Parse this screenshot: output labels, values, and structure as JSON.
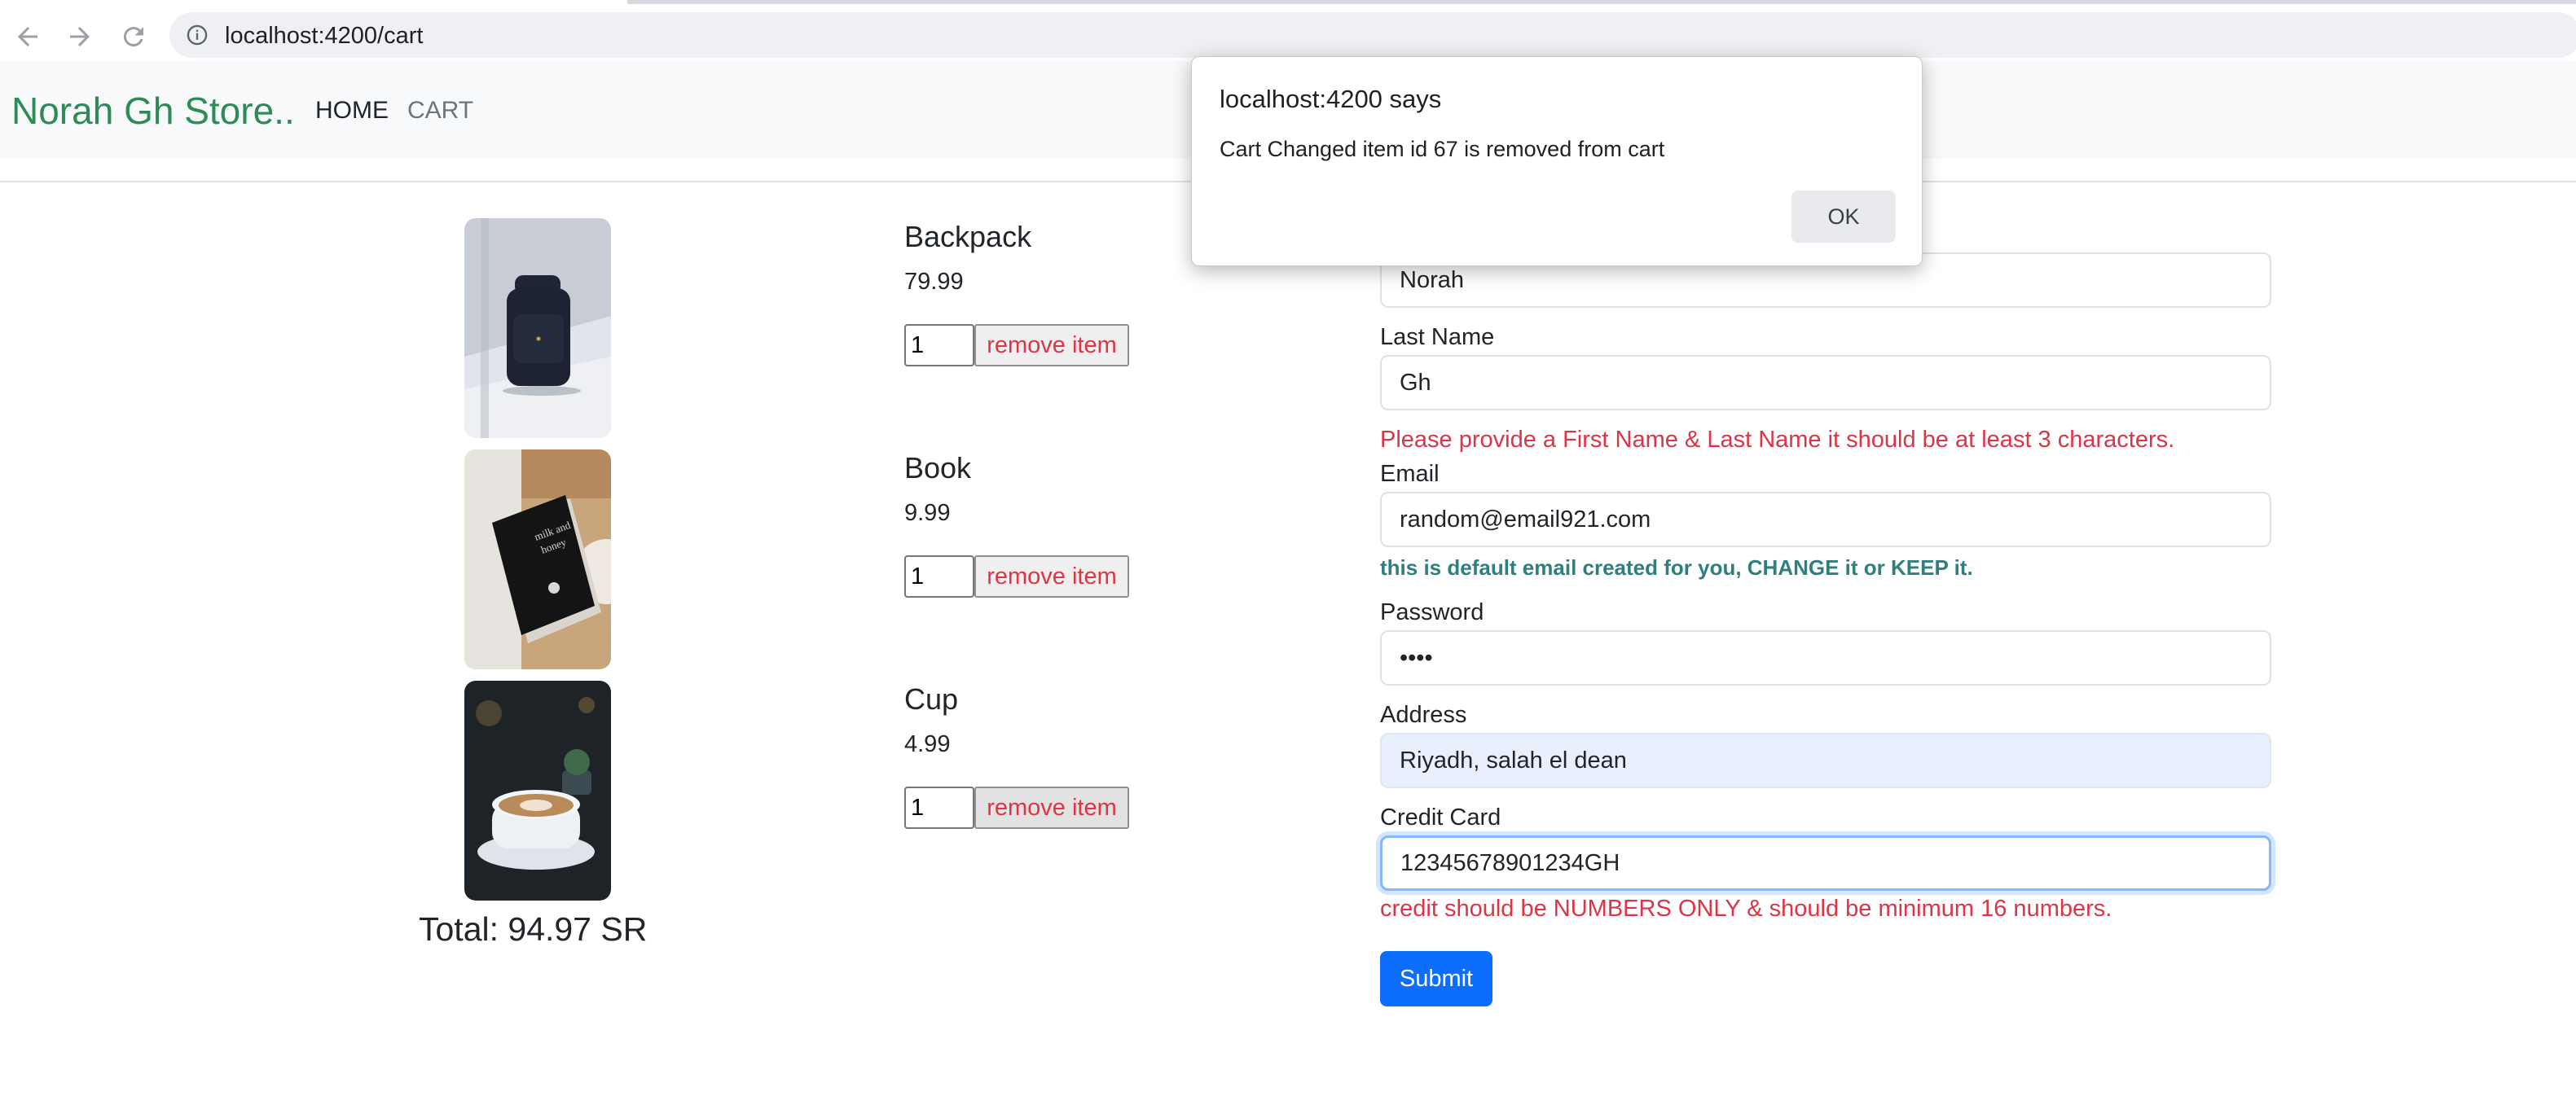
{
  "browser": {
    "url": "localhost:4200/cart",
    "back_icon": "arrow-left-icon",
    "forward_icon": "arrow-right-icon",
    "reload_icon": "reload-icon",
    "site_info_icon": "info-icon"
  },
  "navbar": {
    "brand": "Norah Gh Store..",
    "links": {
      "home": "HOME",
      "cart": "CART"
    },
    "brand_color": "#2e8b57"
  },
  "cart": {
    "items": [
      {
        "name": "Backpack",
        "price": "79.99",
        "quantity": "1",
        "remove_label": "remove item",
        "image": "backpack-photo"
      },
      {
        "name": "Book",
        "price": "9.99",
        "quantity": "1",
        "remove_label": "remove item",
        "image": "book-photo"
      },
      {
        "name": "Cup",
        "price": "4.99",
        "quantity": "1",
        "remove_label": "remove item",
        "image": "coffee-cup-photo"
      }
    ],
    "total": "Total: 94.97 SR"
  },
  "form": {
    "first_name_value": "Norah",
    "last_name_label": "Last Name",
    "last_name_value": "Gh",
    "name_error": "Please provide a First Name & Last Name it should be at least 3 characters.",
    "email_label": "Email",
    "email_value": "random@email921.com",
    "email_hint": "this is default email created for you, CHANGE it or KEEP it.",
    "password_label": "Password",
    "password_value": "••••",
    "address_label": "Address",
    "address_value": "Riyadh, salah el dean",
    "credit_card_label": "Credit Card",
    "credit_card_value": "12345678901234GH",
    "credit_card_error": "credit should be NUMBERS ONLY & should be minimum 16 numbers.",
    "submit_label": "Submit"
  },
  "dialog": {
    "title": "localhost:4200 says",
    "message": "Cart Changed item id 67 is removed from cart",
    "ok_label": "OK"
  },
  "colors": {
    "error": "#dc3545",
    "hint": "#2f7f80",
    "primary": "#0d6efd",
    "autofill": "#e8f0fe"
  }
}
